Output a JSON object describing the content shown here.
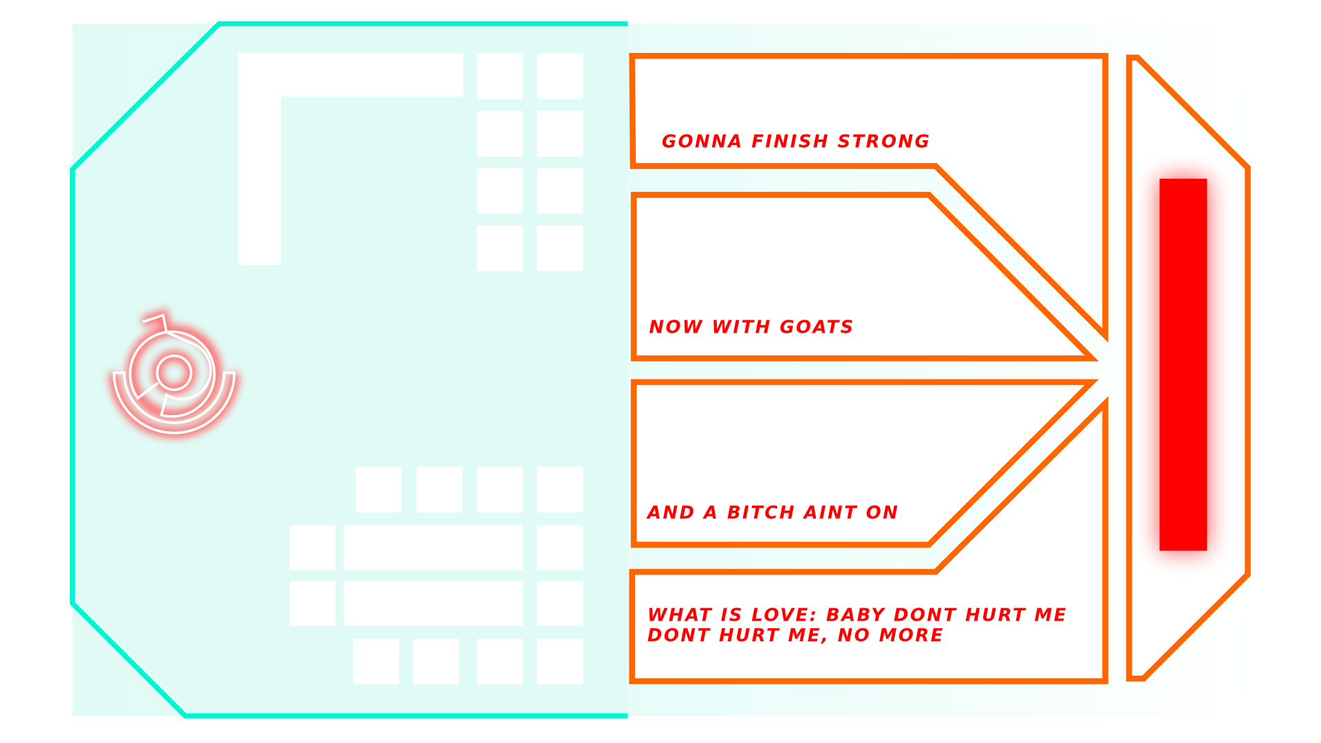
{
  "colors": {
    "frame": "#00f5d0",
    "frame_fill": "#e0fbf6",
    "panel_stroke": "#ff6600",
    "text": "#ff0000",
    "bar": "#ff0000"
  },
  "panels": [
    {
      "label": "GONNA FINISH STRONG"
    },
    {
      "label": "NOW WITH GOATS"
    },
    {
      "label": "AND A BITCH AINT ON"
    },
    {
      "label_line1": "WHAT IS LOVE: BABY DONT HURT ME",
      "label_line2": "DONT HURT ME, NO MORE"
    }
  ],
  "icons": {
    "emblem": "circular-maze-emblem-icon"
  }
}
